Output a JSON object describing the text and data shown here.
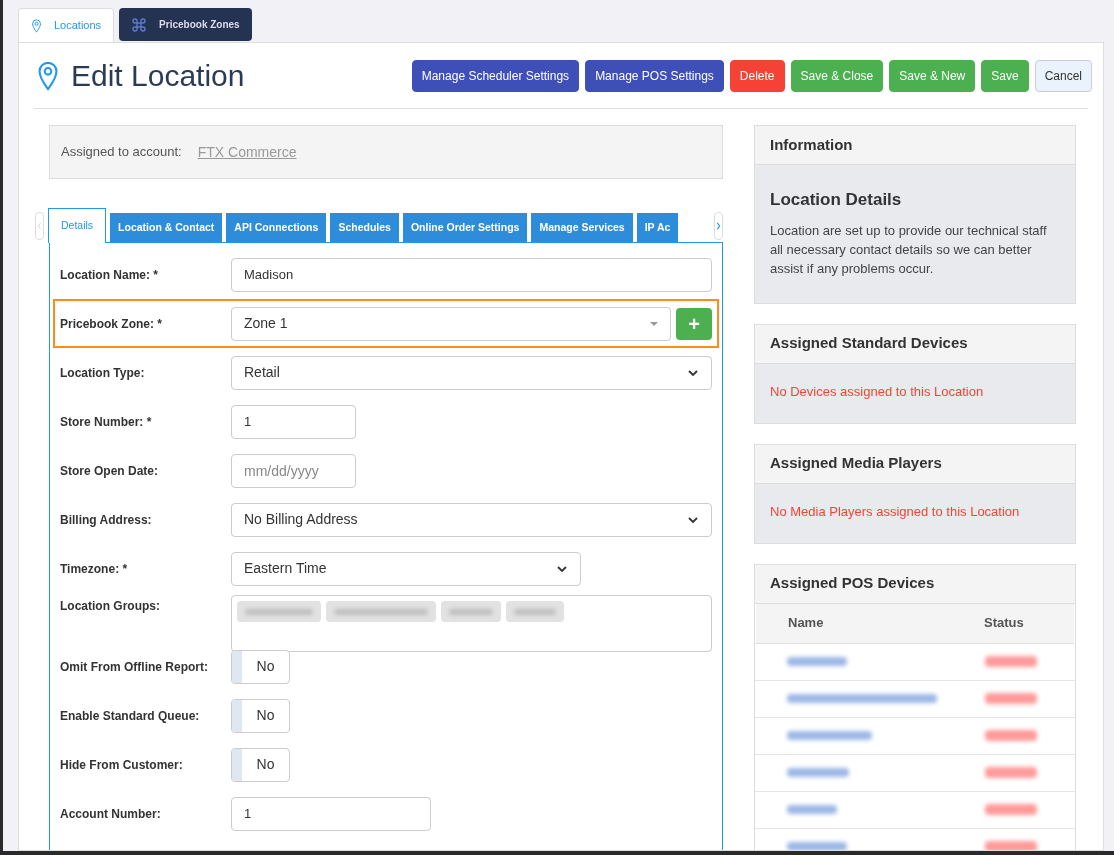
{
  "top_tabs": [
    {
      "label": "Locations",
      "selected": true,
      "kind": "pin"
    },
    {
      "label": "Pricebook Zones",
      "selected": false,
      "kind": "command"
    }
  ],
  "title": "Edit Location",
  "actions": [
    {
      "label": "Manage Scheduler Settings",
      "kind": "indigo"
    },
    {
      "label": "Manage POS Settings",
      "kind": "indigo"
    },
    {
      "label": "Delete",
      "kind": "danger"
    },
    {
      "label": "Save & Close",
      "kind": "success"
    },
    {
      "label": "Save & New",
      "kind": "success"
    },
    {
      "label": "Save",
      "kind": "success"
    },
    {
      "label": "Cancel",
      "kind": "light"
    }
  ],
  "account": {
    "label": "Assigned to account:",
    "link": "FTX Commerce"
  },
  "form_tabs": [
    {
      "label": "Details",
      "selected": true
    },
    {
      "label": "Location & Contact",
      "selected": false
    },
    {
      "label": "API Connections",
      "selected": false
    },
    {
      "label": "Schedules",
      "selected": false
    },
    {
      "label": "Online Order Settings",
      "selected": false
    },
    {
      "label": "Manage Services",
      "selected": false
    },
    {
      "label": "IP Ac",
      "selected": false
    }
  ],
  "fields": [
    {
      "label": "Location Name: *",
      "kind": "text",
      "value": "Madison"
    },
    {
      "label": "Pricebook Zone: *",
      "kind": "combo",
      "value": "Zone 1",
      "add_button": "+",
      "highlighted": true
    },
    {
      "label": "Location Type:",
      "kind": "select",
      "value": "Retail"
    },
    {
      "label": "Store Number: *",
      "kind": "text",
      "value": "1"
    },
    {
      "label": "Store Open Date:",
      "kind": "date",
      "placeholder": "mm/dd/yyyy"
    },
    {
      "label": "Billing Address:",
      "kind": "select",
      "value": "No Billing Address"
    },
    {
      "label": "Timezone: *",
      "kind": "select",
      "value": "Eastern Time"
    },
    {
      "label": "Location Groups:",
      "kind": "tags"
    },
    {
      "label": "Omit From Offline Report:",
      "kind": "switch",
      "on": false,
      "value": "No"
    },
    {
      "label": "Enable Standard Queue:",
      "kind": "switch",
      "on": false,
      "value": "No"
    },
    {
      "label": "Hide From Customer:",
      "kind": "switch",
      "on": false,
      "value": "No"
    },
    {
      "label": "Account Number:",
      "kind": "text",
      "value": "1"
    }
  ],
  "panels": [
    {
      "kind": "info",
      "title": "Information",
      "subtitle": "Location Details",
      "text": "Location are set up to provide our technical staff all necessary contact details so we can better assist if any problems occur."
    },
    {
      "kind": "empty",
      "title": "Assigned Standard Devices",
      "text": "No Devices assigned to this Location"
    },
    {
      "kind": "empty",
      "title": "Assigned Media Players",
      "text": "No Media Players assigned to this Location"
    },
    {
      "kind": "table",
      "title": "Assigned POS Devices",
      "columns": [
        "Name",
        "Status"
      ]
    }
  ]
}
